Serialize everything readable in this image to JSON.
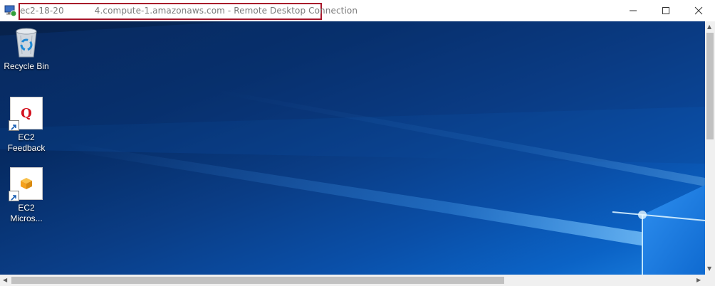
{
  "window": {
    "title": "ec2-18-20           4.compute-1.amazonaws.com - Remote Desktop Connection",
    "icon": "remote-desktop-icon",
    "controls": [
      "minimize",
      "maximize",
      "close"
    ]
  },
  "desktop_icons": [
    {
      "label": "Recycle Bin",
      "icon": "recycle-bin-icon"
    },
    {
      "label": "EC2\nFeedback",
      "icon": "ec2-feedback-q-icon"
    },
    {
      "label": "EC2\nMicros...",
      "icon": "ec2-aws-box-icon"
    }
  ],
  "colors": {
    "title_highlight": "#a8162a",
    "feedback_q": "#d3121f",
    "aws_box": "#f4a11d"
  }
}
